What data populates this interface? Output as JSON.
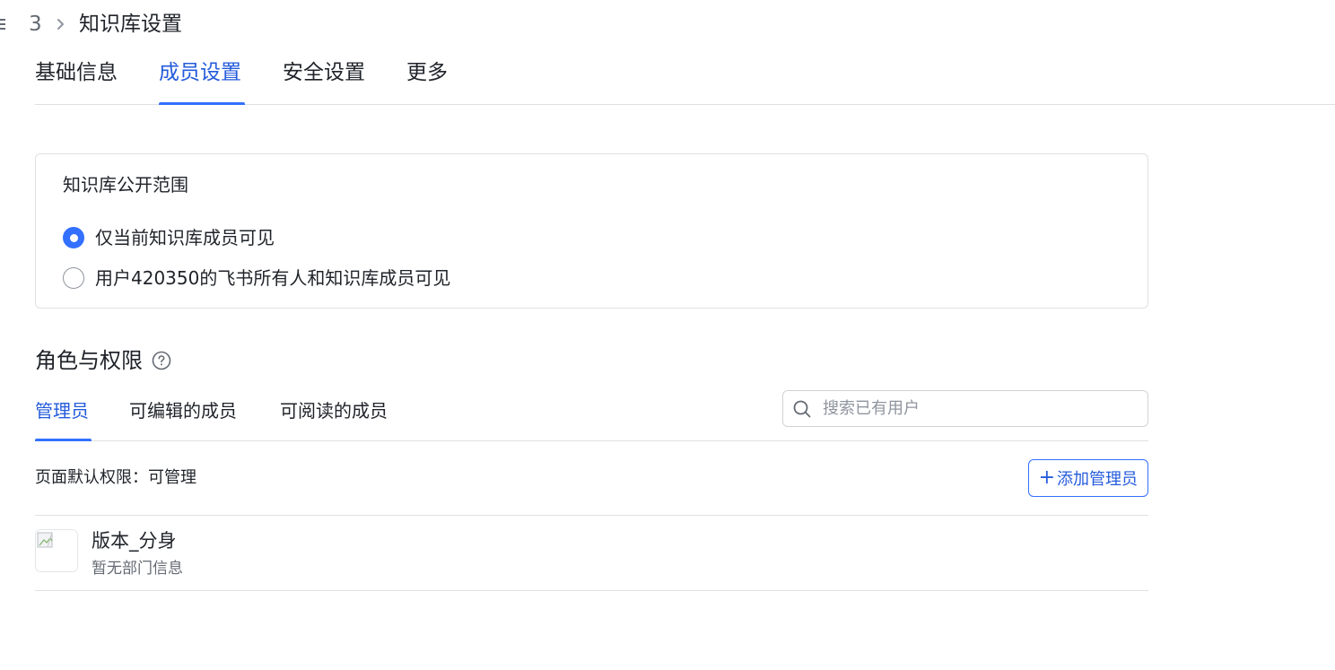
{
  "breadcrumb": {
    "number": "3",
    "title": "知识库设置"
  },
  "main_tabs": [
    {
      "label": "基础信息",
      "active": false
    },
    {
      "label": "成员设置",
      "active": true
    },
    {
      "label": "安全设置",
      "active": false
    },
    {
      "label": "更多",
      "active": false
    }
  ],
  "visibility": {
    "title": "知识库公开范围",
    "options": [
      {
        "label": "仅当前知识库成员可见",
        "checked": true
      },
      {
        "label": "用户420350的飞书所有人和知识库成员可见",
        "checked": false
      }
    ]
  },
  "roles": {
    "title": "角色与权限",
    "tabs": [
      {
        "label": "管理员",
        "active": true
      },
      {
        "label": "可编辑的成员",
        "active": false
      },
      {
        "label": "可阅读的成员",
        "active": false
      }
    ],
    "search": {
      "placeholder": "搜索已有用户",
      "value": ""
    },
    "default_permission": "页面默认权限：可管理",
    "add_button": "添加管理员",
    "add_button_icon": "plus-icon",
    "members": [
      {
        "name": "版本_分身",
        "department": "暂无部门信息",
        "avatar": "broken-image-icon"
      }
    ]
  },
  "colors": {
    "accent": "#3370ff",
    "accent_text": "#245bdb",
    "border": "#dee0e3",
    "text_primary": "#1f2329",
    "text_secondary": "#646a73"
  }
}
